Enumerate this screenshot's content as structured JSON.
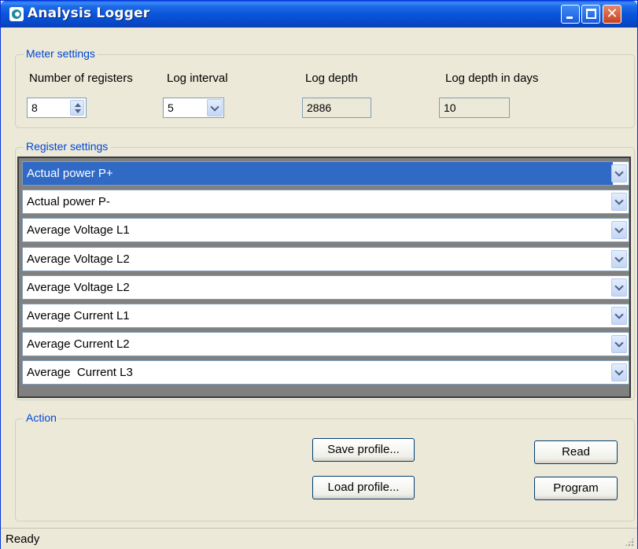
{
  "window": {
    "title": "Analysis Logger"
  },
  "meter_settings": {
    "legend": "Meter settings",
    "number_of_registers": {
      "label": "Number of registers",
      "value": "8"
    },
    "log_interval": {
      "label": "Log interval",
      "value": "5"
    },
    "log_depth": {
      "label": "Log depth",
      "value": "2886"
    },
    "log_depth_days": {
      "label": "Log depth in days",
      "value": "10"
    }
  },
  "register_settings": {
    "legend": "Register settings",
    "registers": [
      {
        "value": "Actual power P+",
        "selected": true
      },
      {
        "value": "Actual power P-",
        "selected": false
      },
      {
        "value": "Average Voltage L1",
        "selected": false
      },
      {
        "value": "Average Voltage L2",
        "selected": false
      },
      {
        "value": "Average Voltage L2",
        "selected": false
      },
      {
        "value": "Average Current L1",
        "selected": false
      },
      {
        "value": "Average Current L2",
        "selected": false
      },
      {
        "value": "Average  Current L3",
        "selected": false
      }
    ]
  },
  "action": {
    "legend": "Action",
    "save_profile": "Save profile...",
    "load_profile": "Load profile...",
    "read": "Read",
    "program": "Program"
  },
  "status": {
    "text": "Ready"
  },
  "colors": {
    "titlebar": "#0A55DB",
    "selection": "#316AC5",
    "legend_text": "#0046D5",
    "window_bg": "#ECE9D8"
  },
  "icons": [
    "app-icon",
    "minimize-icon",
    "maximize-icon",
    "close-icon",
    "spin-up-icon",
    "spin-down-icon",
    "chevron-down-icon",
    "resize-grip-icon"
  ]
}
